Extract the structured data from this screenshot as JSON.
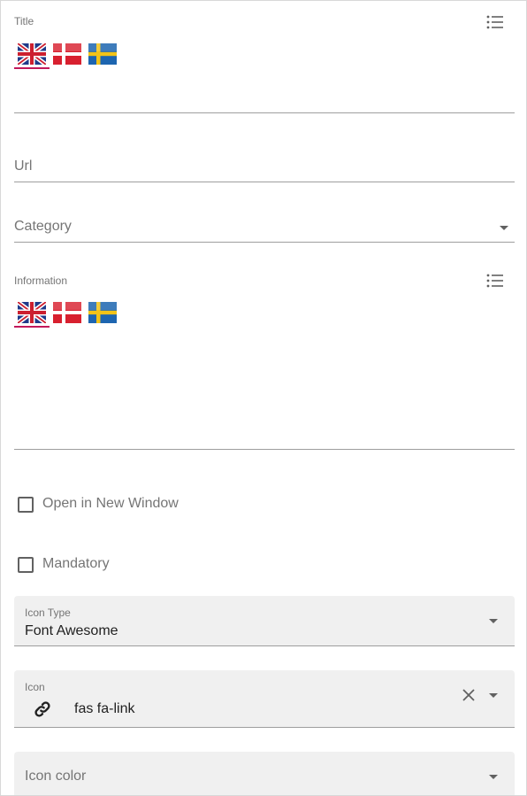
{
  "title_field": {
    "label": "Title",
    "languages": [
      "en",
      "da",
      "sv"
    ],
    "active_language": "en",
    "value": ""
  },
  "url_field": {
    "placeholder": "Url"
  },
  "category_field": {
    "placeholder": "Category"
  },
  "information_field": {
    "label": "Information",
    "languages": [
      "en",
      "da",
      "sv"
    ],
    "active_language": "en",
    "value": ""
  },
  "checkboxes": {
    "open_new_window": {
      "label": "Open in New Window",
      "checked": false
    },
    "mandatory": {
      "label": "Mandatory",
      "checked": false
    }
  },
  "icon_type": {
    "label": "Icon Type",
    "value": "Font Awesome"
  },
  "icon": {
    "label": "Icon",
    "value": "fas fa-link",
    "preview_icon": "link-icon"
  },
  "icon_color": {
    "placeholder": "Icon color"
  },
  "colors": {
    "accent": "#c2185b",
    "line": "#9e9e9e",
    "filled_bg": "#f0f0f0"
  },
  "icons": {
    "list": "format-list-icon",
    "dropdown": "chevron-down-icon",
    "clear": "close-icon"
  }
}
